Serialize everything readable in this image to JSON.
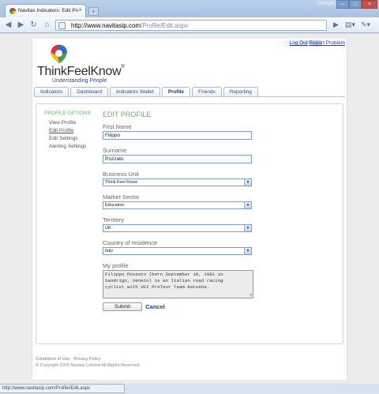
{
  "browser": {
    "tab_title": "Navitas Indicators: Edit Pro...",
    "tab_close": "×",
    "new_tab": "+",
    "window_label": "Google",
    "window_buttons": [
      "–",
      "□",
      "×"
    ],
    "url_host": "http://www.navitasip.com",
    "url_path": "/Profile/Edit.aspx",
    "icons": [
      "back-icon",
      "forward-icon",
      "reload-icon",
      "home-icon",
      "page-icon",
      "bookmark-icon",
      "wrench-icon"
    ],
    "status_url": "http://www.navitasip.com/Profile/Edit.aspx"
  },
  "header": {
    "logout": "Log Out",
    "report": "Report Problem",
    "logo_text": "ThinkFeelKnow",
    "logo_reg": "®",
    "tagline": "Understanding People",
    "logo_colors": [
      "#e8322c",
      "#f39200",
      "#f3c500",
      "#3aa83a",
      "#2b6fd6",
      "#7a3fb0"
    ]
  },
  "nav": {
    "tabs": [
      {
        "label": "Indicators",
        "active": false
      },
      {
        "label": "Dashboard",
        "active": false
      },
      {
        "label": "Indicators Wallet",
        "active": false
      },
      {
        "label": "Profile",
        "active": true
      },
      {
        "label": "Friends",
        "active": false
      },
      {
        "label": "Reporting",
        "active": false
      }
    ]
  },
  "sidebar": {
    "title": "PROFILE OPTIONS",
    "links": [
      "View Profile",
      "Edit Profile",
      "Edit Settings",
      "Alerting Settings"
    ],
    "active_index": 1
  },
  "form": {
    "title": "EDIT PROFILE",
    "first_name_label": "First Name",
    "first_name": "Filippo",
    "surname_label": "Surname",
    "surname": "Pozzato",
    "business_unit_label": "Business Unit",
    "business_unit": "Think Feel Know",
    "market_sector_label": "Market Sector",
    "market_sector": "Education",
    "territory_label": "Territory",
    "territory": "UK",
    "country_label": "Country of residence",
    "country": "Italy",
    "profile_label": "My profile",
    "profile_text": "Filippo Pozzato (born September 10, 1981 in\nSandrigo, Veneto) is an Italian road racing\ncyclist with UCI ProTour Team Katusha.",
    "submit": "Submit",
    "cancel": "Cancel"
  },
  "footer": {
    "conditions": "Conditions of Use",
    "separator": "·",
    "privacy": "Privacy Policy",
    "copyright": "© Copyright 2009 Navitas Limited All Rights Reserved"
  },
  "colors": {
    "accent_green": "#6cb36c",
    "link_blue": "#1a3fa8",
    "tagline_blue": "#3346a0"
  }
}
